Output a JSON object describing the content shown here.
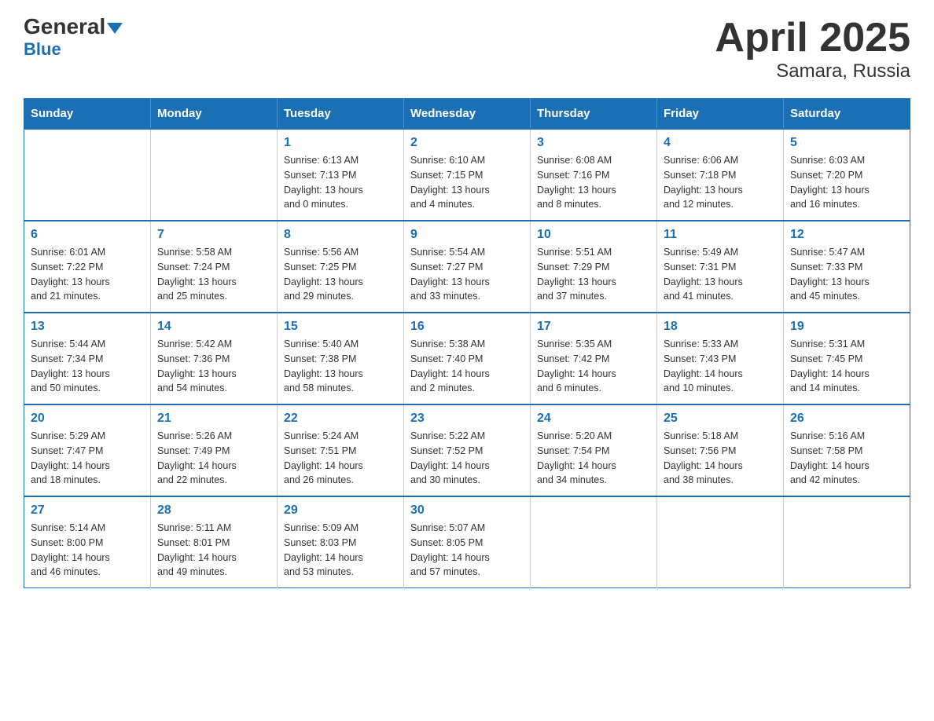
{
  "header": {
    "logo_main": "General",
    "logo_blue": "Blue",
    "title": "April 2025",
    "subtitle": "Samara, Russia"
  },
  "calendar": {
    "days_of_week": [
      "Sunday",
      "Monday",
      "Tuesday",
      "Wednesday",
      "Thursday",
      "Friday",
      "Saturday"
    ],
    "weeks": [
      [
        {
          "day": "",
          "info": ""
        },
        {
          "day": "",
          "info": ""
        },
        {
          "day": "1",
          "info": "Sunrise: 6:13 AM\nSunset: 7:13 PM\nDaylight: 13 hours\nand 0 minutes."
        },
        {
          "day": "2",
          "info": "Sunrise: 6:10 AM\nSunset: 7:15 PM\nDaylight: 13 hours\nand 4 minutes."
        },
        {
          "day": "3",
          "info": "Sunrise: 6:08 AM\nSunset: 7:16 PM\nDaylight: 13 hours\nand 8 minutes."
        },
        {
          "day": "4",
          "info": "Sunrise: 6:06 AM\nSunset: 7:18 PM\nDaylight: 13 hours\nand 12 minutes."
        },
        {
          "day": "5",
          "info": "Sunrise: 6:03 AM\nSunset: 7:20 PM\nDaylight: 13 hours\nand 16 minutes."
        }
      ],
      [
        {
          "day": "6",
          "info": "Sunrise: 6:01 AM\nSunset: 7:22 PM\nDaylight: 13 hours\nand 21 minutes."
        },
        {
          "day": "7",
          "info": "Sunrise: 5:58 AM\nSunset: 7:24 PM\nDaylight: 13 hours\nand 25 minutes."
        },
        {
          "day": "8",
          "info": "Sunrise: 5:56 AM\nSunset: 7:25 PM\nDaylight: 13 hours\nand 29 minutes."
        },
        {
          "day": "9",
          "info": "Sunrise: 5:54 AM\nSunset: 7:27 PM\nDaylight: 13 hours\nand 33 minutes."
        },
        {
          "day": "10",
          "info": "Sunrise: 5:51 AM\nSunset: 7:29 PM\nDaylight: 13 hours\nand 37 minutes."
        },
        {
          "day": "11",
          "info": "Sunrise: 5:49 AM\nSunset: 7:31 PM\nDaylight: 13 hours\nand 41 minutes."
        },
        {
          "day": "12",
          "info": "Sunrise: 5:47 AM\nSunset: 7:33 PM\nDaylight: 13 hours\nand 45 minutes."
        }
      ],
      [
        {
          "day": "13",
          "info": "Sunrise: 5:44 AM\nSunset: 7:34 PM\nDaylight: 13 hours\nand 50 minutes."
        },
        {
          "day": "14",
          "info": "Sunrise: 5:42 AM\nSunset: 7:36 PM\nDaylight: 13 hours\nand 54 minutes."
        },
        {
          "day": "15",
          "info": "Sunrise: 5:40 AM\nSunset: 7:38 PM\nDaylight: 13 hours\nand 58 minutes."
        },
        {
          "day": "16",
          "info": "Sunrise: 5:38 AM\nSunset: 7:40 PM\nDaylight: 14 hours\nand 2 minutes."
        },
        {
          "day": "17",
          "info": "Sunrise: 5:35 AM\nSunset: 7:42 PM\nDaylight: 14 hours\nand 6 minutes."
        },
        {
          "day": "18",
          "info": "Sunrise: 5:33 AM\nSunset: 7:43 PM\nDaylight: 14 hours\nand 10 minutes."
        },
        {
          "day": "19",
          "info": "Sunrise: 5:31 AM\nSunset: 7:45 PM\nDaylight: 14 hours\nand 14 minutes."
        }
      ],
      [
        {
          "day": "20",
          "info": "Sunrise: 5:29 AM\nSunset: 7:47 PM\nDaylight: 14 hours\nand 18 minutes."
        },
        {
          "day": "21",
          "info": "Sunrise: 5:26 AM\nSunset: 7:49 PM\nDaylight: 14 hours\nand 22 minutes."
        },
        {
          "day": "22",
          "info": "Sunrise: 5:24 AM\nSunset: 7:51 PM\nDaylight: 14 hours\nand 26 minutes."
        },
        {
          "day": "23",
          "info": "Sunrise: 5:22 AM\nSunset: 7:52 PM\nDaylight: 14 hours\nand 30 minutes."
        },
        {
          "day": "24",
          "info": "Sunrise: 5:20 AM\nSunset: 7:54 PM\nDaylight: 14 hours\nand 34 minutes."
        },
        {
          "day": "25",
          "info": "Sunrise: 5:18 AM\nSunset: 7:56 PM\nDaylight: 14 hours\nand 38 minutes."
        },
        {
          "day": "26",
          "info": "Sunrise: 5:16 AM\nSunset: 7:58 PM\nDaylight: 14 hours\nand 42 minutes."
        }
      ],
      [
        {
          "day": "27",
          "info": "Sunrise: 5:14 AM\nSunset: 8:00 PM\nDaylight: 14 hours\nand 46 minutes."
        },
        {
          "day": "28",
          "info": "Sunrise: 5:11 AM\nSunset: 8:01 PM\nDaylight: 14 hours\nand 49 minutes."
        },
        {
          "day": "29",
          "info": "Sunrise: 5:09 AM\nSunset: 8:03 PM\nDaylight: 14 hours\nand 53 minutes."
        },
        {
          "day": "30",
          "info": "Sunrise: 5:07 AM\nSunset: 8:05 PM\nDaylight: 14 hours\nand 57 minutes."
        },
        {
          "day": "",
          "info": ""
        },
        {
          "day": "",
          "info": ""
        },
        {
          "day": "",
          "info": ""
        }
      ]
    ]
  }
}
